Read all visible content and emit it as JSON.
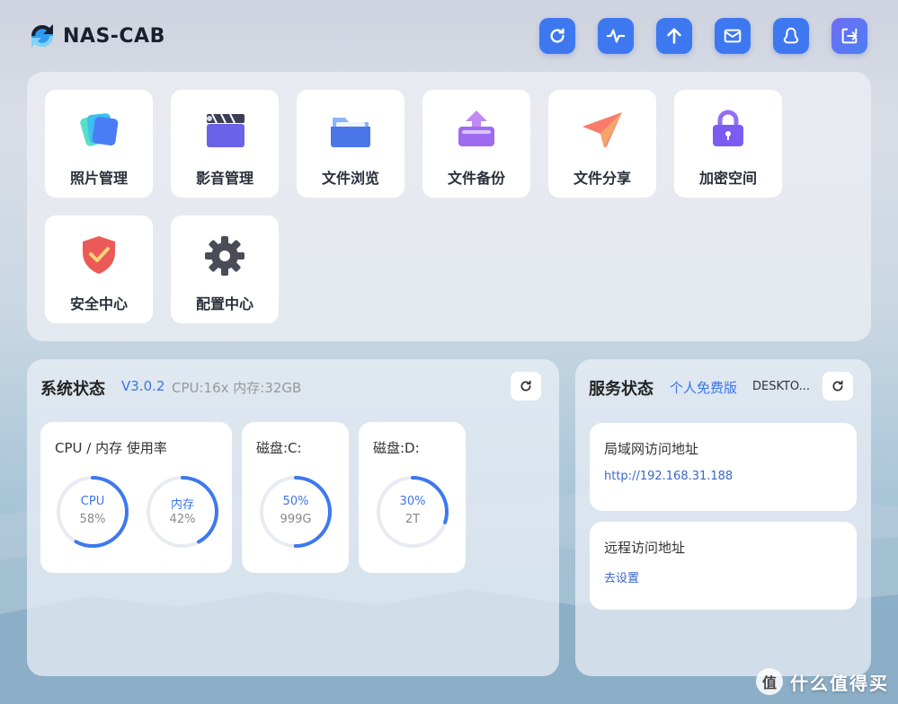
{
  "app": {
    "logo_text": "NAS-CAB"
  },
  "topbar": {
    "buttons": [
      {
        "icon": "refresh-icon"
      },
      {
        "icon": "activity-icon"
      },
      {
        "icon": "upload-icon"
      },
      {
        "icon": "mail-icon"
      },
      {
        "icon": "user-icon"
      },
      {
        "icon": "logout-icon"
      }
    ]
  },
  "apps": [
    {
      "label": "照片管理",
      "icon": "photos-icon"
    },
    {
      "label": "影音管理",
      "icon": "video-icon"
    },
    {
      "label": "文件浏览",
      "icon": "folder-icon"
    },
    {
      "label": "文件备份",
      "icon": "backup-icon"
    },
    {
      "label": "文件分享",
      "icon": "share-icon"
    },
    {
      "label": "加密空间",
      "icon": "lock-icon"
    },
    {
      "label": "安全中心",
      "icon": "shield-icon"
    },
    {
      "label": "配置中心",
      "icon": "gear-icon"
    }
  ],
  "system": {
    "title": "系统状态",
    "version": "V3.0.2",
    "specs": "CPU:16x 内存:32GB",
    "usage_card": {
      "title": "CPU / 内存 使用率",
      "cpu": {
        "name": "CPU",
        "value": "58%",
        "fraction": 0.58
      },
      "mem": {
        "name": "内存",
        "value": "42%",
        "fraction": 0.42
      }
    },
    "disk_c": {
      "title": "磁盘:C:",
      "percent": "50%",
      "size": "999G",
      "fraction": 0.5
    },
    "disk_d": {
      "title": "磁盘:D:",
      "percent": "30%",
      "size": "2T",
      "fraction": 0.3
    }
  },
  "service": {
    "title": "服务状态",
    "edition": "个人免费版",
    "device": "DESKTO...",
    "lan": {
      "title": "局域网访问地址",
      "link": "http://192.168.31.188"
    },
    "remote": {
      "title": "远程访问地址",
      "link": "去设置"
    }
  },
  "colors": {
    "accent": "#3d78f0",
    "gauge_track": "#e8ebf2"
  },
  "watermark": {
    "text": "什么值得买",
    "mark": "值"
  }
}
